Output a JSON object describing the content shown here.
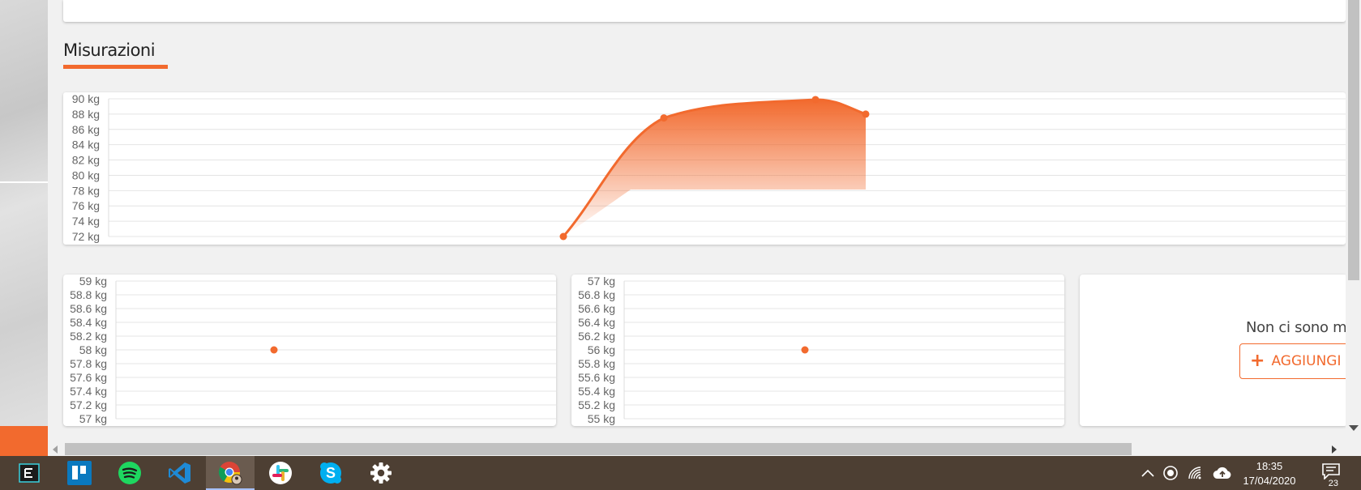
{
  "section": {
    "title": "Misurazioni"
  },
  "charts": {
    "main": {
      "y_ticks": [
        "90 kg",
        "88 kg",
        "86 kg",
        "84 kg",
        "82 kg",
        "80 kg",
        "78 kg",
        "76 kg",
        "74 kg",
        "72 kg"
      ]
    },
    "small1": {
      "y_ticks": [
        "59 kg",
        "58.8 kg",
        "58.6 kg",
        "58.4 kg",
        "58.2 kg",
        "58 kg",
        "57.8 kg",
        "57.6 kg",
        "57.4 kg",
        "57.2 kg",
        "57 kg"
      ]
    },
    "small2": {
      "y_ticks": [
        "57 kg",
        "56.8 kg",
        "56.6 kg",
        "56.4 kg",
        "56.2 kg",
        "56 kg",
        "55.8 kg",
        "55.6 kg",
        "55.4 kg",
        "55.2 kg",
        "55 kg"
      ]
    }
  },
  "chart_data": [
    {
      "type": "area",
      "ylim": [
        72,
        90
      ],
      "yunit": "kg",
      "y": [
        72,
        87.5,
        89.9,
        88.0
      ],
      "color": "#f26a2e"
    },
    {
      "type": "scatter",
      "ylim": [
        57,
        59
      ],
      "yunit": "kg",
      "y": [
        58
      ],
      "color": "#f26a2e"
    },
    {
      "type": "scatter",
      "ylim": [
        55,
        57
      ],
      "yunit": "kg",
      "y": [
        56
      ],
      "color": "#f26a2e"
    }
  ],
  "empty_card": {
    "message": "Non ci sono m",
    "button_label": "AGGIUNGI",
    "button_icon": "plus-icon"
  },
  "taskbar": {
    "apps": [
      "edge-dev-icon",
      "trello-icon",
      "spotify-icon",
      "vscode-icon",
      "chrome-icon",
      "slack-icon",
      "skype-icon",
      "settings-icon"
    ],
    "time": "18:35",
    "date": "17/04/2020",
    "notifications": "23"
  },
  "colors": {
    "accent": "#f26a2e",
    "taskbar": "#4d3f33"
  }
}
